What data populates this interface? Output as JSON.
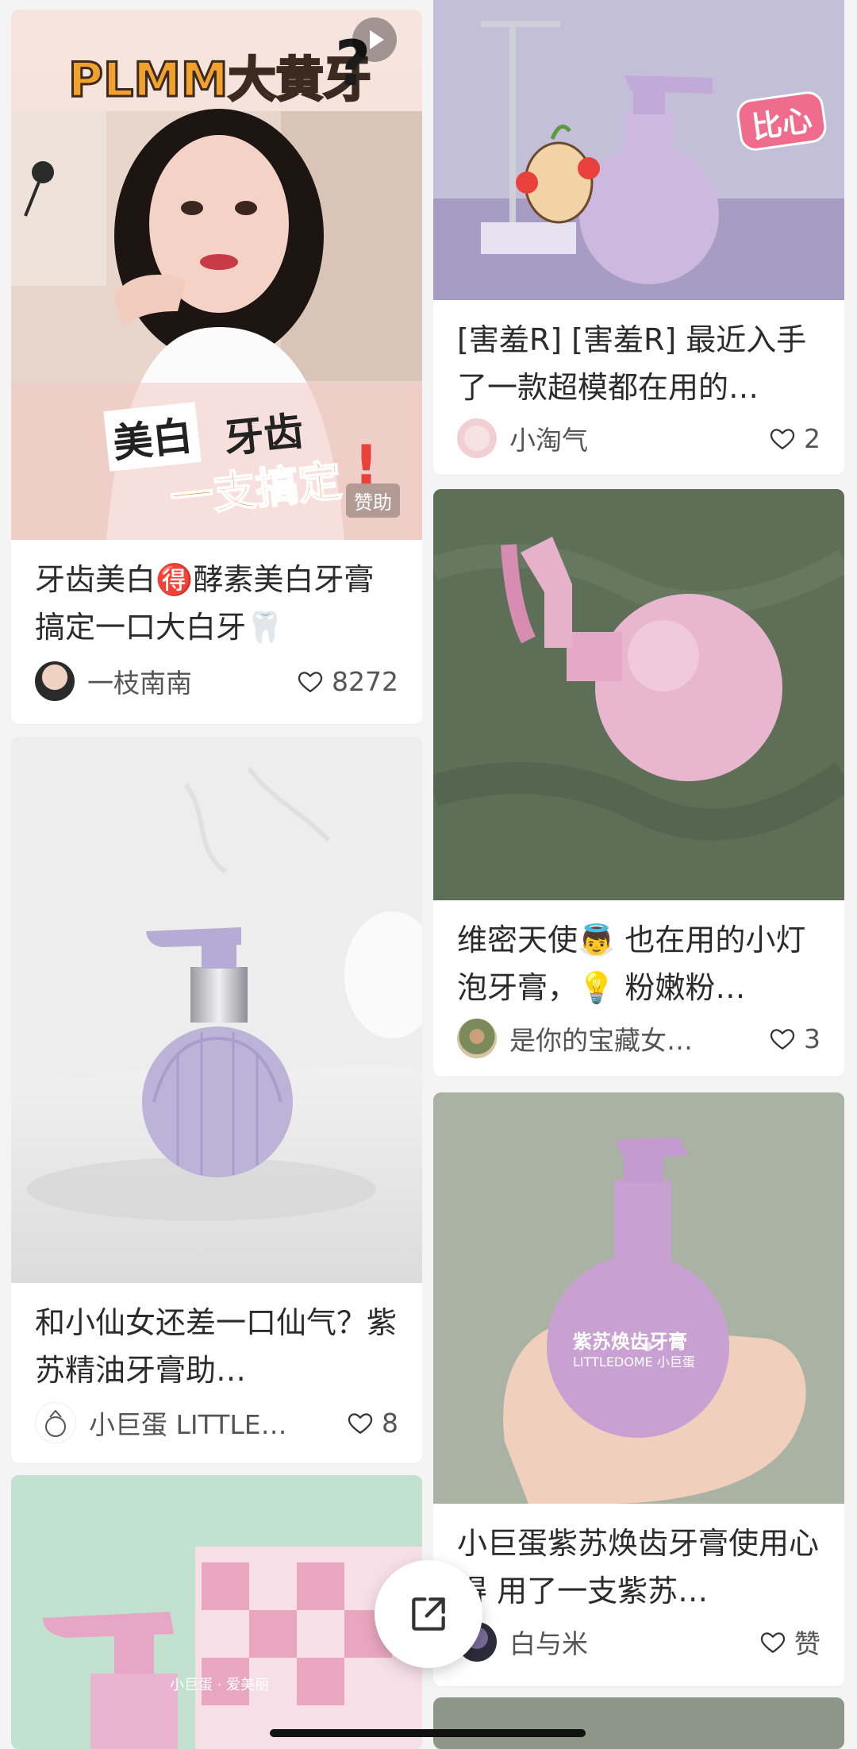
{
  "feed": {
    "left": [
      {
        "overlay_title": "PLMM大黄牙",
        "overlay_badge_1": "美白",
        "overlay_badge_2": "牙齿",
        "overlay_badge_3": "一支搞定",
        "sponsor": "赞助",
        "title": "牙齿美白🉐酵素美白牙膏搞定一口大白牙🦷",
        "author": "一枝南南",
        "likes": "8272"
      },
      {
        "title": "和小仙女还差一口仙气？紫苏精油牙膏助…",
        "author": "小巨蛋 LITTLE…",
        "likes": "8"
      },
      {
        "box_text": "小巨蛋 · 爱美丽"
      }
    ],
    "right": [
      {
        "sticker": "比心",
        "title": "[害羞R] [害羞R] 最近入手了一款超模都在用的…",
        "author": "小淘气",
        "likes": "2"
      },
      {
        "title": "维密天使👼 也在用的小灯泡牙膏，💡 粉嫩粉…",
        "author": "是你的宝藏女…",
        "likes": "3"
      },
      {
        "bottle_text_1": "紫苏焕齿牙膏",
        "bottle_text_2": "LITTLEDOME 小巨蛋",
        "title": "小巨蛋紫苏焕齿牙膏使用心得 用了一支紫苏…",
        "author": "白与米",
        "likes": "赞"
      }
    ]
  },
  "colors": {
    "accent_red": "#e8413c",
    "heart_stroke": "#333333",
    "lilac": "#b9a7d9",
    "pink": "#e6a8c8"
  }
}
